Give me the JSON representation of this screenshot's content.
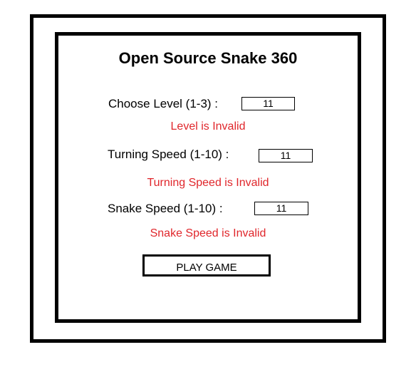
{
  "title": "Open Source Snake 360",
  "form": {
    "level": {
      "label": "Choose Level (1-3) :",
      "value": "11",
      "error": "Level is Invalid"
    },
    "turning_speed": {
      "label": "Turning Speed (1-10) :",
      "value": "11",
      "error": "Turning Speed is Invalid"
    },
    "snake_speed": {
      "label": "Snake Speed (1-10) :",
      "value": "11",
      "error": "Snake Speed is Invalid"
    }
  },
  "play_button_label": "PLAY GAME",
  "colors": {
    "error": "#e0262b",
    "border": "#000000",
    "background": "#ffffff"
  }
}
